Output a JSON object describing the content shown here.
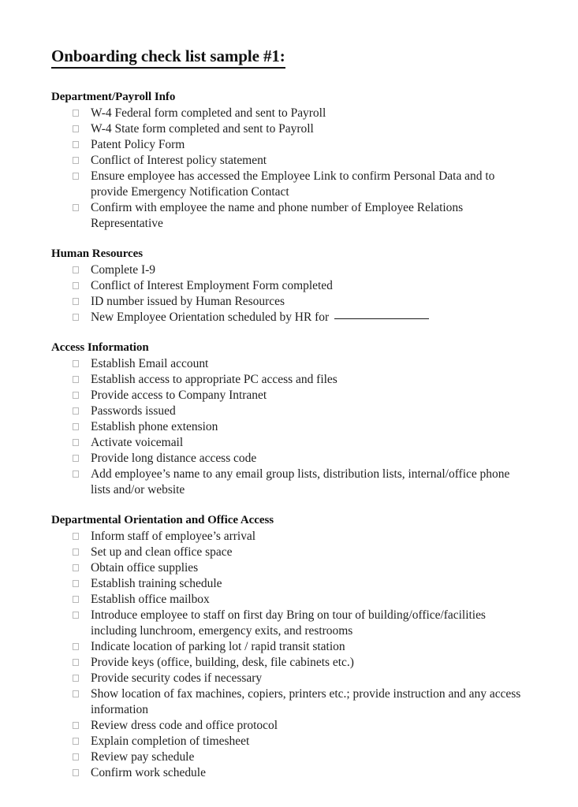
{
  "document": {
    "title": "Onboarding check list sample #1:",
    "checkbox_icon": "empty-checkbox",
    "text_color": "#1f1f1f",
    "checkbox_border_color": "#b9b9b9",
    "background_color": "#ffffff"
  },
  "sections": [
    {
      "heading": "Department/Payroll Info",
      "items": [
        {
          "text": "W-4 Federal form completed and sent to Payroll",
          "blank": false
        },
        {
          "text": "W-4 State form completed and sent to Payroll",
          "blank": false
        },
        {
          "text": "Patent Policy Form",
          "blank": false
        },
        {
          "text": "Conflict of Interest policy statement",
          "blank": false
        },
        {
          "text": "Ensure employee has accessed the Employee Link to confirm Personal Data and to provide Emergency Notification Contact",
          "blank": false
        },
        {
          "text": "Confirm with employee the name and phone number of Employee Relations Representative",
          "blank": false
        }
      ]
    },
    {
      "heading": "Human Resources",
      "items": [
        {
          "text": "Complete I-9",
          "blank": false
        },
        {
          "text": "Conflict of Interest Employment Form completed",
          "blank": false
        },
        {
          "text": "ID number issued by Human Resources",
          "blank": false
        },
        {
          "text": "New Employee Orientation scheduled by HR for",
          "blank": true
        }
      ]
    },
    {
      "heading": "Access Information",
      "items": [
        {
          "text": "Establish Email account",
          "blank": false
        },
        {
          "text": "Establish access to appropriate PC access and files",
          "blank": false
        },
        {
          "text": "Provide access to Company Intranet",
          "blank": false
        },
        {
          "text": "Passwords issued",
          "blank": false
        },
        {
          "text": "Establish phone extension",
          "blank": false
        },
        {
          "text": "Activate voicemail",
          "blank": false
        },
        {
          "text": "Provide long distance access code",
          "blank": false
        },
        {
          "text": "Add employee’s name to any email group lists, distribution lists, internal/office phone lists and/or website",
          "blank": false
        }
      ]
    },
    {
      "heading": "Departmental Orientation and Office Access",
      "items": [
        {
          "text": "Inform staff of employee’s arrival",
          "blank": false
        },
        {
          "text": "Set up and clean office space",
          "blank": false
        },
        {
          "text": "Obtain office supplies",
          "blank": false
        },
        {
          "text": "Establish training schedule",
          "blank": false
        },
        {
          "text": "Establish office mailbox",
          "blank": false
        },
        {
          "text": "Introduce employee to staff on first day Bring on tour of building/office/facilities including lunchroom, emergency exits, and restrooms",
          "blank": false
        },
        {
          "text": "Indicate location of parking lot / rapid transit station",
          "blank": false
        },
        {
          "text": "Provide keys (office, building, desk, file cabinets etc.)",
          "blank": false
        },
        {
          "text": "Provide security codes if necessary",
          "blank": false
        },
        {
          "text": "Show location of fax machines, copiers, printers etc.; provide instruction and any access information",
          "blank": false
        },
        {
          "text": "Review dress code and office protocol",
          "blank": false
        },
        {
          "text": "Explain completion of timesheet",
          "blank": false
        },
        {
          "text": "Review pay schedule",
          "blank": false
        },
        {
          "text": "Confirm work schedule",
          "blank": false
        }
      ]
    }
  ]
}
